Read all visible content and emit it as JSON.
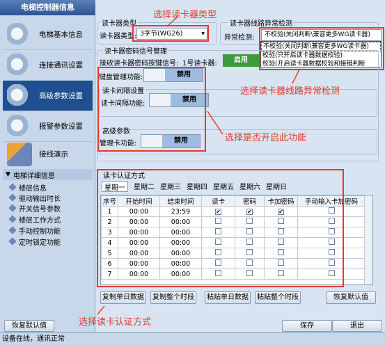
{
  "app_title": "电梯控制器信息",
  "nav": [
    {
      "label": "电梯基本信息",
      "icon": "gear-icon"
    },
    {
      "label": "连接通讯设置",
      "icon": "gear-network-icon"
    },
    {
      "label": "高级参数设置",
      "icon": "advanced-settings-icon"
    },
    {
      "label": "报警参数设置",
      "icon": "alarm-gear-icon"
    },
    {
      "label": "接线演示",
      "icon": "wiring-icon"
    }
  ],
  "detail": {
    "header": "电梯详细信息",
    "items": [
      "楼层信息",
      "驱动输出时长",
      "开关信号参数",
      "楼层工作方式",
      "手动控制功能",
      "定时锁定功能"
    ]
  },
  "reader_type": {
    "group": "读卡器类型",
    "label": "读卡器类型:",
    "value": "3字节(WG26)"
  },
  "line_check": {
    "group": "读卡器线路异常检测",
    "label": "异常检测:",
    "value": "不校验(关闭判断\\兼容更多WG读卡器)",
    "options": [
      "不校验(关闭判断\\兼容更多WG读卡器)",
      "校验(只开启读卡器数据校验)",
      "校验(开启读卡器数据校验和接错判断"
    ]
  },
  "password_group": {
    "title": "读卡器密码信号管理",
    "receive_label": "接收读卡器密码按键信号:",
    "reader1_label": "1号读卡器:",
    "enable_label": "启用",
    "keypad_label": "键盘管理功能:",
    "keypad_value": "禁用"
  },
  "interval_group": {
    "title": "读卡间隔设置",
    "label": "读卡间隔功能:",
    "value": "禁用"
  },
  "advanced_group": {
    "title": "高级参数",
    "label": "管理卡功能:",
    "value": "禁用"
  },
  "auth": {
    "title": "读卡认证方式",
    "days": [
      "星期一",
      "星期二",
      "星期三",
      "星期四",
      "星期五",
      "星期六",
      "星期日"
    ],
    "columns": [
      "序号",
      "开始时间",
      "结束时间",
      "读卡",
      "密码",
      "卡加密码",
      "手动输入卡加密码"
    ],
    "rows": [
      {
        "no": "1",
        "start": "00:00",
        "end": "23:59",
        "checks": [
          true,
          true,
          true,
          false
        ]
      },
      {
        "no": "2",
        "start": "00:00",
        "end": "00:00",
        "checks": [
          false,
          false,
          false,
          false
        ]
      },
      {
        "no": "3",
        "start": "00:00",
        "end": "00:00",
        "checks": [
          false,
          false,
          false,
          false
        ]
      },
      {
        "no": "4",
        "start": "00:00",
        "end": "00:00",
        "checks": [
          false,
          false,
          false,
          false
        ]
      },
      {
        "no": "5",
        "start": "00:00",
        "end": "00:00",
        "checks": [
          false,
          false,
          false,
          false
        ]
      },
      {
        "no": "6",
        "start": "00:00",
        "end": "00:00",
        "checks": [
          false,
          false,
          false,
          false
        ]
      },
      {
        "no": "7",
        "start": "00:00",
        "end": "00:00",
        "checks": [
          false,
          false,
          false,
          false
        ]
      }
    ],
    "buttons": [
      "复制单日数据",
      "复制整个时段",
      "粘贴单日数据",
      "粘贴整个时段"
    ],
    "restore": "恢复默认值"
  },
  "annotations": {
    "reader_type": "选择读卡器类型",
    "line_check": "选择读卡器线路异常检测",
    "enable_func": "选择是否开启此功能",
    "auth": "选择读卡认证方式"
  },
  "bottom": {
    "restore": "恢复默认值",
    "save": "保存",
    "exit": "退出"
  },
  "status": "设备在线，通讯正常",
  "colors": {
    "accent_red": "#e23b2e",
    "nav_active": "#1f4f8f",
    "enable_green": "#3c9b3c"
  }
}
